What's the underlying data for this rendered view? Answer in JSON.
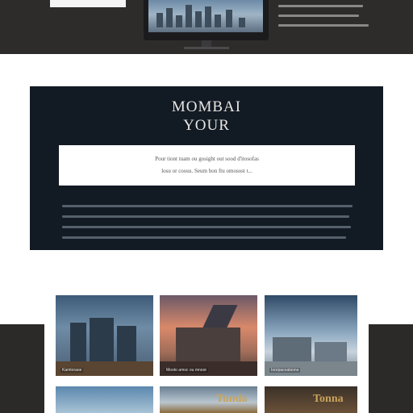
{
  "hero": {
    "title_line1": "MOMBAI",
    "title_line2": "YOUR",
    "box_line1": "Pour tiont tuam ou gosight out sood d'itosofas",
    "box_line2": "losu or coous. Seum bon ftu omosost t..."
  },
  "gallery": {
    "items": [
      {
        "caption": "Kamtoraoe"
      },
      {
        "caption": "Mooto amoc ou mnoor"
      },
      {
        "caption": "Ioorpacoatsone"
      },
      {
        "caption": ""
      },
      {
        "caption": "Tunda"
      },
      {
        "caption": "Tonna"
      }
    ]
  },
  "colors": {
    "top_band": "#2e2c2b",
    "hero_bg": "#121a24",
    "gallery_bg": "#ffffff"
  }
}
